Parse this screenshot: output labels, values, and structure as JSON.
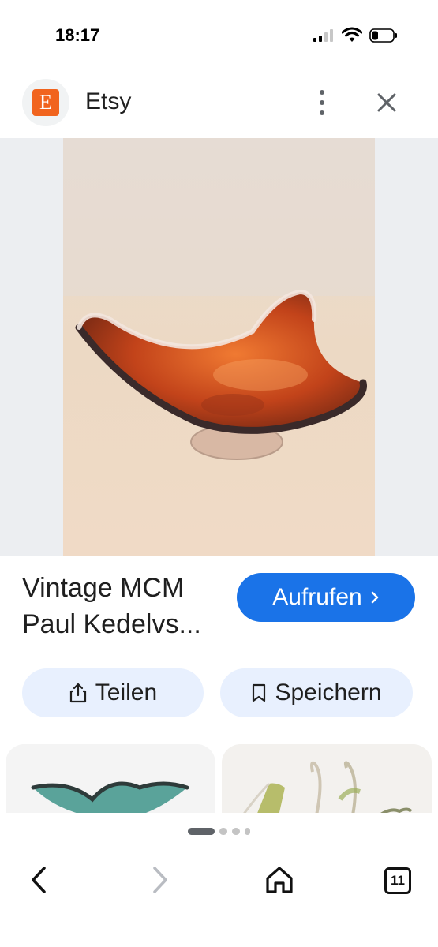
{
  "status_bar": {
    "time": "18:17",
    "battery_level": 0.3
  },
  "header": {
    "site_name": "Etsy",
    "logo_letter": "E"
  },
  "result": {
    "title": "Vintage MCM Paul Kedelvs...",
    "visit_label": "Aufrufen",
    "share_label": "Teilen",
    "save_label": "Speichern"
  },
  "pagination": {
    "total_dots": 4,
    "active_index": 0
  },
  "navigation": {
    "tab_count": "11"
  },
  "colors": {
    "etsy_orange": "#f1641e",
    "primary_blue": "#1a73e8",
    "chip_bg": "#e8f0fe"
  },
  "icons": [
    "more-vert-icon",
    "close-icon",
    "share-icon",
    "bookmark-icon",
    "chevron-right-icon",
    "back-icon",
    "forward-icon",
    "home-icon",
    "tabs-icon"
  ]
}
